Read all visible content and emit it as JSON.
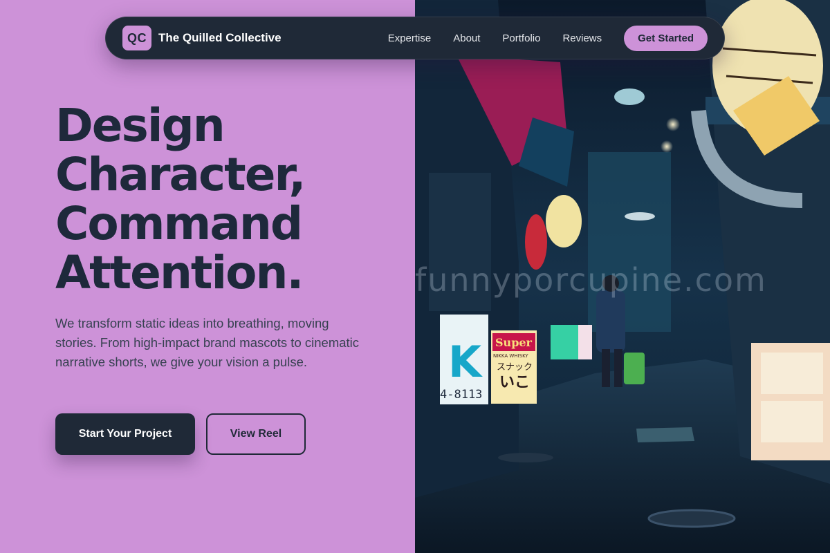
{
  "nav": {
    "logo_text": "QC",
    "brand": "The Quilled Collective",
    "links": [
      "Expertise",
      "About",
      "Portfolio",
      "Reviews"
    ],
    "cta": "Get Started"
  },
  "hero": {
    "headline_lines": [
      "Design",
      "Character,",
      "Command",
      "Attention."
    ],
    "subtext": "We transform static ideas into breathing, moving stories. From high-impact brand mascots to cinematic narrative shorts, we give your vision a pulse.",
    "primary_button": "Start Your Project",
    "secondary_button": "View Reel"
  },
  "image": {
    "watermark": "funnyporcupine.com",
    "signs": {
      "k_sign": "K",
      "phone": "4-8113",
      "super_sign": "Super",
      "super_sub": "NIKKA WHISKY",
      "snack": "スナック",
      "snack_name": "いこ"
    }
  },
  "colors": {
    "background": "#cd92d8",
    "navy": "#1f2937",
    "headline": "#1e293b",
    "body_text": "#374151",
    "accent": "#cd92d8"
  }
}
